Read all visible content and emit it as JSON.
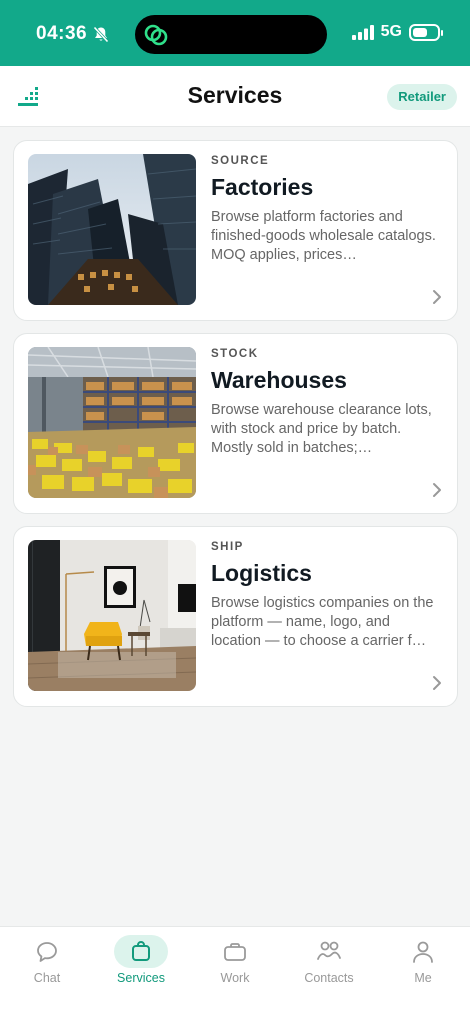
{
  "status": {
    "time": "04:36",
    "network": "5G"
  },
  "header": {
    "title": "Services",
    "role_badge": "Retailer"
  },
  "cards": [
    {
      "eyebrow": "SOURCE",
      "title": "Factories",
      "description": "Browse platform factories and finished-goods wholesale catalogs. MOQ applies, prices…",
      "image": "skyscrapers-photo"
    },
    {
      "eyebrow": "STOCK",
      "title": "Warehouses",
      "description": "Browse warehouse clearance lots, with stock and price by batch. Mostly sold in batches;…",
      "image": "warehouse-photo"
    },
    {
      "eyebrow": "SHIP",
      "title": "Logistics",
      "description": "Browse logistics companies on the platform — name, logo, and location — to choose a carrier f…",
      "image": "interior-photo"
    }
  ],
  "tabbar": [
    {
      "label": "Chat",
      "icon": "chat-bubble-icon",
      "active": false
    },
    {
      "label": "Services",
      "icon": "bag-icon",
      "active": true
    },
    {
      "label": "Work",
      "icon": "briefcase-icon",
      "active": false
    },
    {
      "label": "Contacts",
      "icon": "contacts-icon",
      "active": false
    },
    {
      "label": "Me",
      "icon": "person-icon",
      "active": false
    }
  ],
  "colors": {
    "brand": "#12a98a",
    "accent_text": "#129a7c",
    "accent_bg": "#dcf3ec"
  }
}
